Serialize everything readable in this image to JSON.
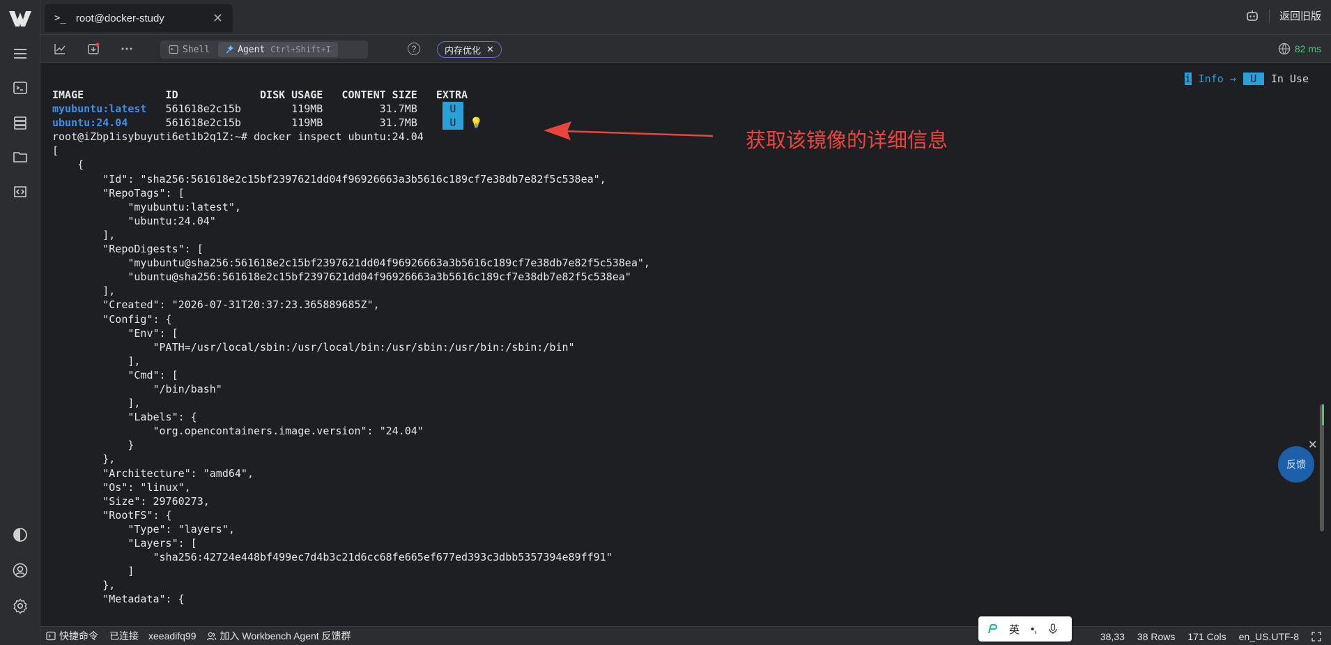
{
  "titlebar": {
    "tab_prompt": ">_",
    "tab_title": "root@docker-study",
    "tab_close": "✕",
    "old_version_label": "返回旧版"
  },
  "toolbar": {
    "shell_label": "Shell",
    "agent_label": "Agent",
    "agent_shortcut": "Ctrl+Shift+I",
    "help_label": "?",
    "memory_chip_label": "内存优化",
    "chip_close": "✕",
    "latency": "82 ms"
  },
  "terminal": {
    "legend_i": "i",
    "legend_info": "Info →",
    "legend_u": "U",
    "legend_inuse": "In Use",
    "header": "IMAGE             ID             DISK USAGE   CONTENT SIZE   EXTRA",
    "row1_name": "myubuntu:latest",
    "row1_rest": "   561618e2c15b        119MB         31.7MB    ",
    "row2_name": "ubuntu:24.04",
    "row2_rest": "      561618e2c15b        119MB         31.7MB    ",
    "badge_u": "U",
    "bulb": "💡",
    "body": "root@iZbp1isybuyuti6et1b2q1Z:~# docker inspect ubuntu:24.04\n[\n    {\n        \"Id\": \"sha256:561618e2c15bf2397621dd04f96926663a3b5616c189cf7e38db7e82f5c538ea\",\n        \"RepoTags\": [\n            \"myubuntu:latest\",\n            \"ubuntu:24.04\"\n        ],\n        \"RepoDigests\": [\n            \"myubuntu@sha256:561618e2c15bf2397621dd04f96926663a3b5616c189cf7e38db7e82f5c538ea\",\n            \"ubuntu@sha256:561618e2c15bf2397621dd04f96926663a3b5616c189cf7e38db7e82f5c538ea\"\n        ],\n        \"Created\": \"2026-07-31T20:37:23.365889685Z\",\n        \"Config\": {\n            \"Env\": [\n                \"PATH=/usr/local/sbin:/usr/local/bin:/usr/sbin:/usr/bin:/sbin:/bin\"\n            ],\n            \"Cmd\": [\n                \"/bin/bash\"\n            ],\n            \"Labels\": {\n                \"org.opencontainers.image.version\": \"24.04\"\n            }\n        },\n        \"Architecture\": \"amd64\",\n        \"Os\": \"linux\",\n        \"Size\": 29760273,\n        \"RootFS\": {\n            \"Type\": \"layers\",\n            \"Layers\": [\n                \"sha256:42724e448bf499ec7d4b3c21d6cc68fe665ef677ed393c3dbb5357394e89ff91\"\n            ]\n        },\n        \"Metadata\": {",
    "annotation": "获取该镜像的详细信息",
    "feedback_label": "反馈",
    "feedback_close": "✕"
  },
  "statusbar": {
    "quick_commands": "快捷命令",
    "connected": "已连接",
    "user": "xeeadifq99",
    "join_group": "加入 Workbench Agent 反馈群",
    "cursor_pos": "38,33",
    "rows": "38 Rows",
    "cols": "171 Cols",
    "encoding": "en_US.UTF-8"
  },
  "ime": {
    "lang": "英",
    "punct": "•,"
  },
  "colors": {
    "accent_blue": "#2aa0d8",
    "annotation_red": "#e8453c",
    "latency_green": "#4ec27b"
  }
}
